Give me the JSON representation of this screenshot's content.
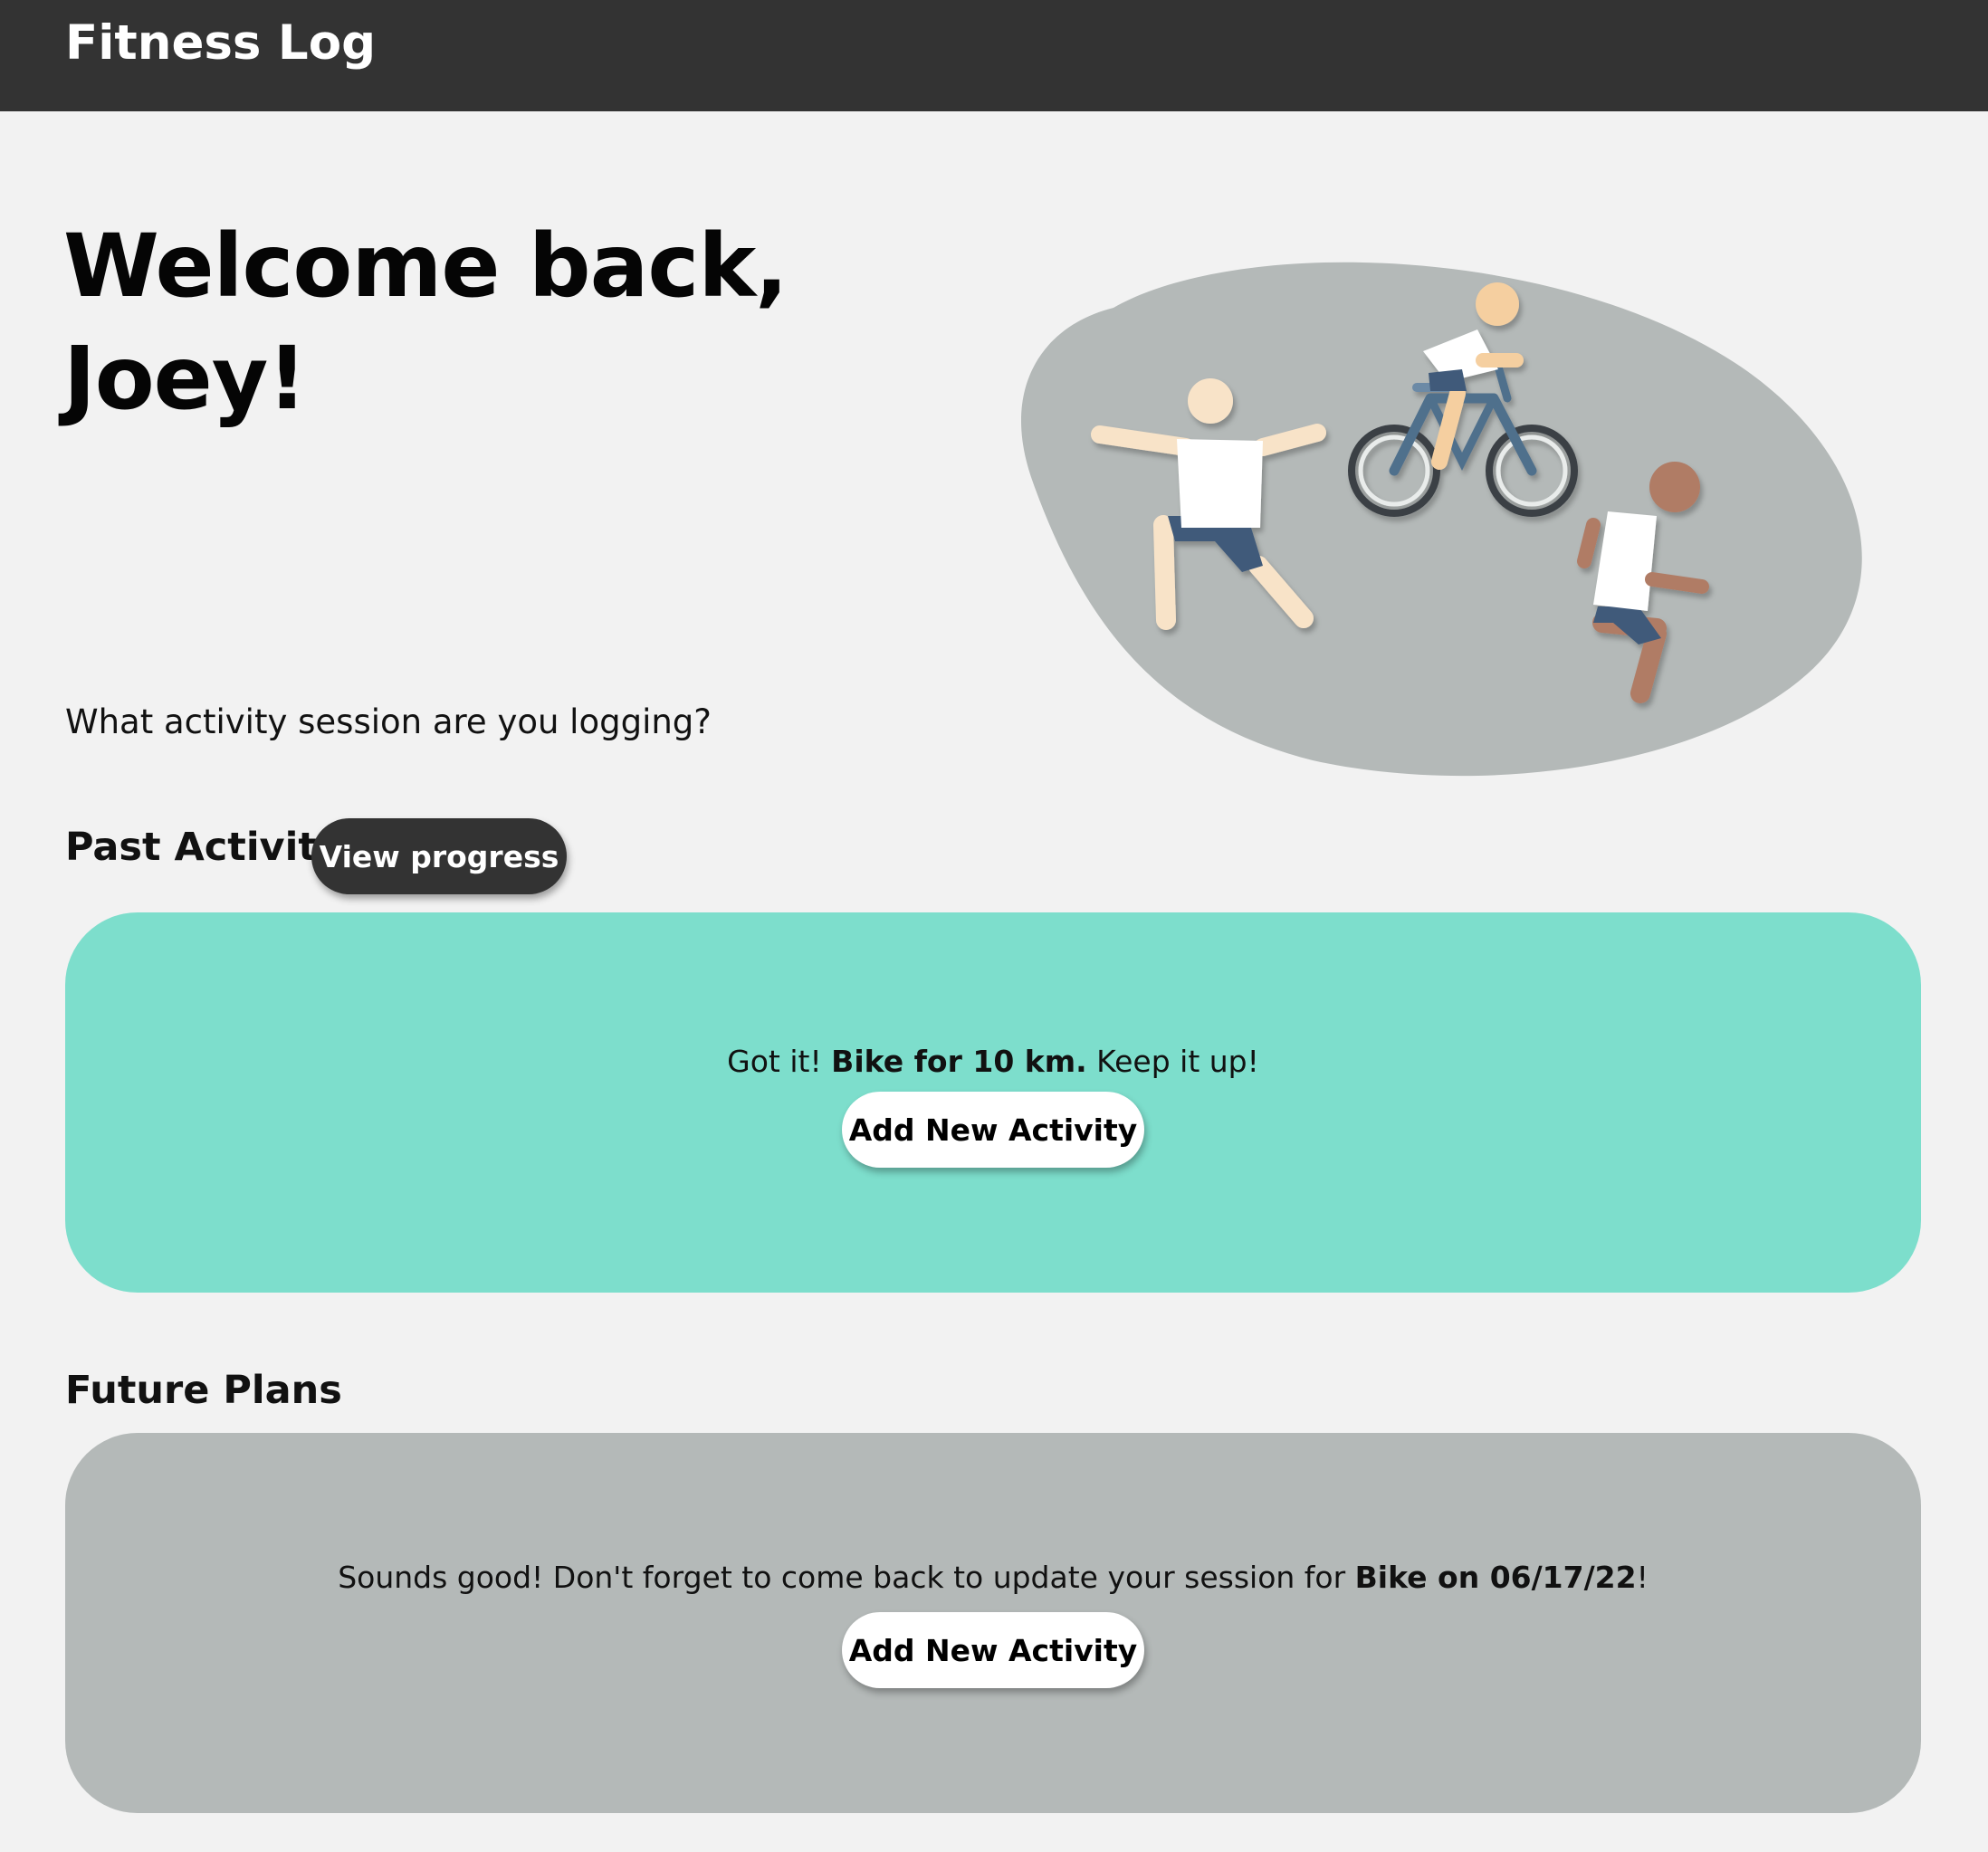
{
  "header": {
    "app_title": "Fitness Log"
  },
  "welcome": {
    "line1": "Welcome back,",
    "line2": "Joey!"
  },
  "prompt": "What activity session are you logging?",
  "past_activity": {
    "title": "Past Activity",
    "view_progress_label": "View progress",
    "message_prefix": "Got it! ",
    "message_bold": "Bike for 10 km.",
    "message_suffix": " Keep it up!",
    "button_label": "Add New Activity"
  },
  "future_plans": {
    "title": "Future Plans",
    "message_prefix": "Sounds good! Don't forget to come back to update your session for ",
    "message_bold": "Bike on 06/17/22",
    "message_suffix": "!",
    "button_label": "Add New Activity"
  },
  "colors": {
    "header_bg": "#333333",
    "page_bg": "#f2f2f2",
    "past_card_bg": "#7ddecc",
    "future_card_bg": "#b4b9b8",
    "hero_blob": "#b4b9b8"
  },
  "illustration": {
    "icons": [
      "stretching-person-icon",
      "cyclist-icon",
      "runner-icon"
    ]
  }
}
